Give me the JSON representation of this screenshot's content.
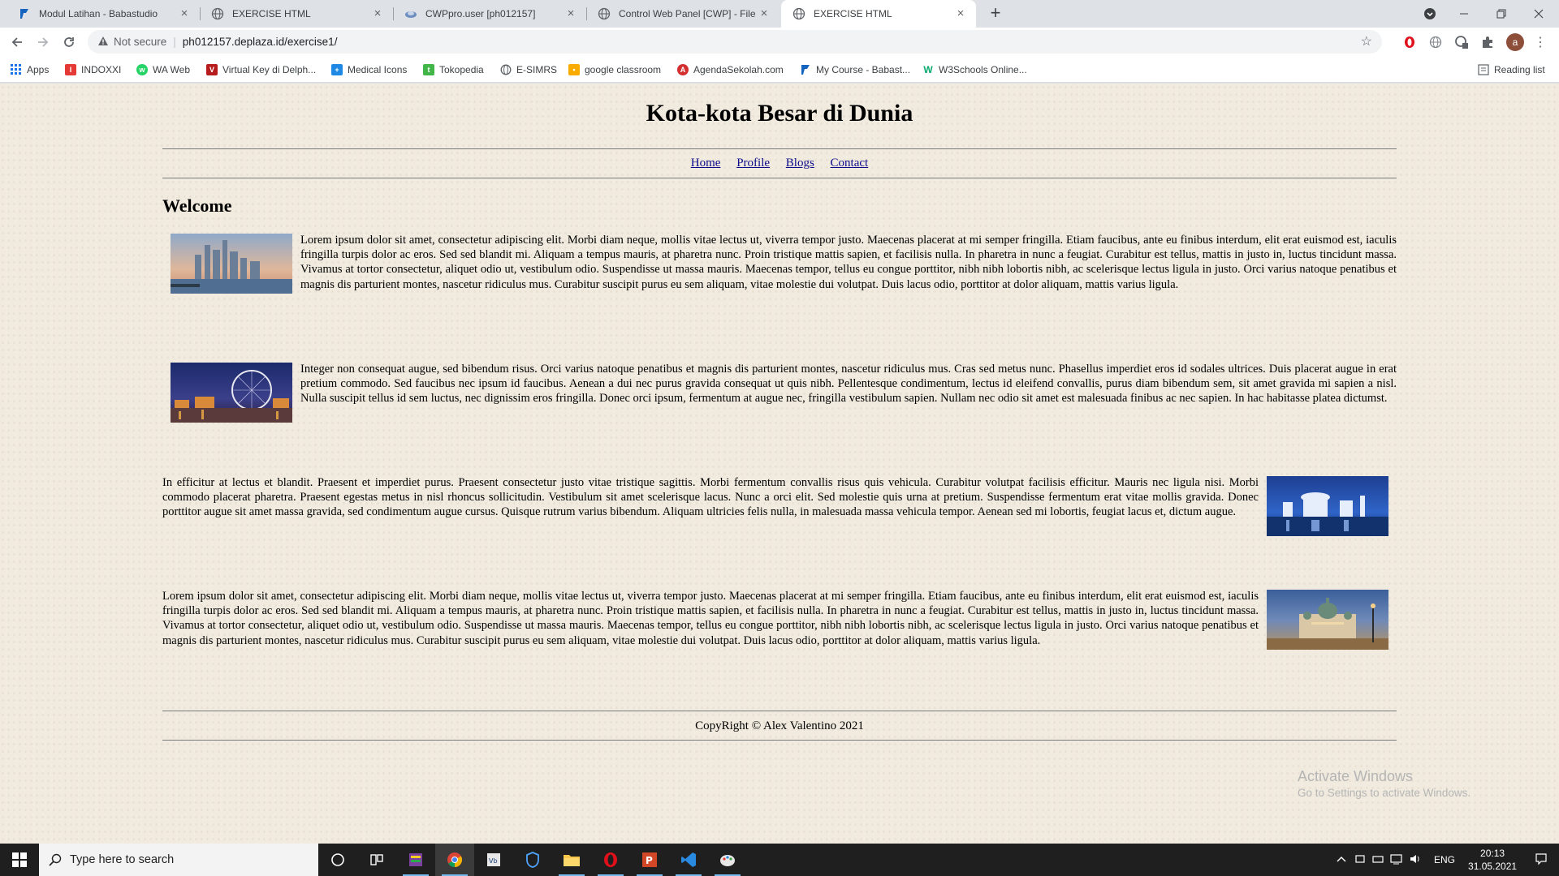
{
  "browser": {
    "tabs": [
      {
        "title": "Modul Latihan - Babastudio",
        "icon": "babastudio-icon",
        "active": false
      },
      {
        "title": "EXERCISE HTML",
        "icon": "globe-icon",
        "active": false
      },
      {
        "title": "CWPpro.user [ph012157]",
        "icon": "cwp-icon",
        "active": false
      },
      {
        "title": "Control Web Panel [CWP] - File M",
        "icon": "globe-icon",
        "active": false
      },
      {
        "title": "EXERCISE HTML",
        "icon": "globe-icon",
        "active": true
      }
    ],
    "security_label": "Not secure",
    "url": "ph012157.deplaza.id/exercise1/",
    "profile_initial": "a",
    "bookmarks": [
      {
        "label": "Apps",
        "icon": "apps-grid-icon",
        "color": "#1a73e8"
      },
      {
        "label": "INDOXXI",
        "icon": "indoxxi-icon",
        "color": "#e53935"
      },
      {
        "label": "WA Web",
        "icon": "whatsapp-icon",
        "color": "#25d366"
      },
      {
        "label": "Virtual Key di Delph...",
        "icon": "delphi-icon",
        "color": "#b71c1c"
      },
      {
        "label": "Medical Icons",
        "icon": "medical-icon",
        "color": "#1e88e5"
      },
      {
        "label": "Tokopedia",
        "icon": "tokopedia-icon",
        "color": "#42b549"
      },
      {
        "label": "E-SIMRS",
        "icon": "globe-icon",
        "color": "#5f6368"
      },
      {
        "label": "google classroom",
        "icon": "classroom-icon",
        "color": "#f9ab00"
      },
      {
        "label": "AgendaSekolah.com",
        "icon": "agenda-icon",
        "color": "#d32f2f"
      },
      {
        "label": "My Course - Babast...",
        "icon": "babastudio-icon",
        "color": "#1565c0"
      },
      {
        "label": "W3Schools Online...",
        "icon": "w3schools-icon",
        "color": "#04aa6d"
      }
    ],
    "reading_list": "Reading list"
  },
  "page": {
    "title": "Kota-kota Besar di Dunia",
    "nav": [
      "Home",
      "Profile",
      "Blogs",
      "Contact"
    ],
    "heading": "Welcome",
    "articles": [
      {
        "image": "city-skyline-dusk",
        "image_side": "left",
        "text": "Lorem ipsum dolor sit amet, consectetur adipiscing elit. Morbi diam neque, mollis vitae lectus ut, viverra tempor justo. Maecenas placerat at mi semper fringilla. Etiam faucibus, ante eu finibus interdum, elit erat euismod est, iaculis fringilla turpis dolor ac eros. Sed sed blandit mi. Aliquam a tempus mauris, at pharetra nunc. Proin tristique mattis sapien, et facilisis nulla. In pharetra in nunc a feugiat. Curabitur est tellus, mattis in justo in, luctus tincidunt massa. Vivamus at tortor consectetur, aliquet odio ut, vestibulum odio. Suspendisse ut massa mauris. Maecenas tempor, tellus eu congue porttitor, nibh nibh lobortis nibh, ac scelerisque lectus ligula in justo. Orci varius natoque penatibus et magnis dis parturient montes, nascetur ridiculus mus. Curabitur suscipit purus eu sem aliquam, vitae molestie dui volutpat. Duis lacus odio, porttitor at dolor aliquam, mattis varius ligula."
      },
      {
        "image": "ferris-wheel-night",
        "image_side": "left",
        "text": "Integer non consequat augue, sed bibendum risus. Orci varius natoque penatibus et magnis dis parturient montes, nascetur ridiculus mus. Cras sed metus nunc. Phasellus imperdiet eros id sodales ultrices. Duis placerat augue in erat pretium commodo. Sed faucibus nec ipsum id faucibus. Aenean a dui nec purus gravida consequat ut quis nibh. Pellentesque condimentum, lectus id eleifend convallis, purus diam bibendum sem, sit amet gravida mi sapien a nisl. Nulla suscipit tellus id sem luctus, nec dignissim eros fringilla. Donec orci ipsum, fermentum at augue nec, fringilla vestibulum sapien. Nullam nec odio sit amet est malesuada finibus ac nec sapien. In hac habitasse platea dictumst."
      },
      {
        "image": "harbor-night-blue",
        "image_side": "right",
        "text": "In efficitur at lectus et blandit. Praesent et imperdiet purus. Praesent consectetur justo vitae tristique sagittis. Morbi fermentum convallis risus quis vehicula. Curabitur volutpat facilisis efficitur. Mauris nec ligula nisi. Morbi commodo placerat pharetra. Praesent egestas metus in nisl rhoncus sollicitudin. Vestibulum sit amet scelerisque lacus. Nunc a orci elit. Sed molestie quis urna at pretium. Suspendisse fermentum erat vitae mollis gravida. Donec porttitor augue sit amet massa gravida, sed condimentum augue cursus. Quisque rutrum varius bibendum. Aliquam ultricies felis nulla, in malesuada massa vehicula tempor. Aenean sed mi lobortis, feugiat lacus et, dictum augue."
      },
      {
        "image": "cathedral-twilight",
        "image_side": "right",
        "text": "Lorem ipsum dolor sit amet, consectetur adipiscing elit. Morbi diam neque, mollis vitae lectus ut, viverra tempor justo. Maecenas placerat at mi semper fringilla. Etiam faucibus, ante eu finibus interdum, elit erat euismod est, iaculis fringilla turpis dolor ac eros. Sed sed blandit mi. Aliquam a tempus mauris, at pharetra nunc. Proin tristique mattis sapien, et facilisis nulla. In pharetra in nunc a feugiat. Curabitur est tellus, mattis in justo in, luctus tincidunt massa. Vivamus at tortor consectetur, aliquet odio ut, vestibulum odio. Suspendisse ut massa mauris. Maecenas tempor, tellus eu congue porttitor, nibh nibh lobortis nibh, ac scelerisque lectus ligula in justo. Orci varius natoque penatibus et magnis dis parturient montes, nascetur ridiculus mus. Curabitur suscipit purus eu sem aliquam, vitae molestie dui volutpat. Duis lacus odio, porttitor at dolor aliquam, mattis varius ligula."
      }
    ],
    "footer": "CopyRight © Alex Valentino 2021"
  },
  "watermark": {
    "line1": "Activate Windows",
    "line2": "Go to Settings to activate Windows."
  },
  "taskbar": {
    "search_placeholder": "Type here to search",
    "apps": [
      "cortana-icon",
      "task-view-icon",
      "winrar-icon",
      "chrome-icon",
      "vbox-icon",
      "defender-icon",
      "file-explorer-icon",
      "opera-icon",
      "powerpoint-icon",
      "vscode-icon",
      "paint-icon"
    ],
    "language": "ENG",
    "time": "20:13",
    "date": "31.05.2021"
  }
}
